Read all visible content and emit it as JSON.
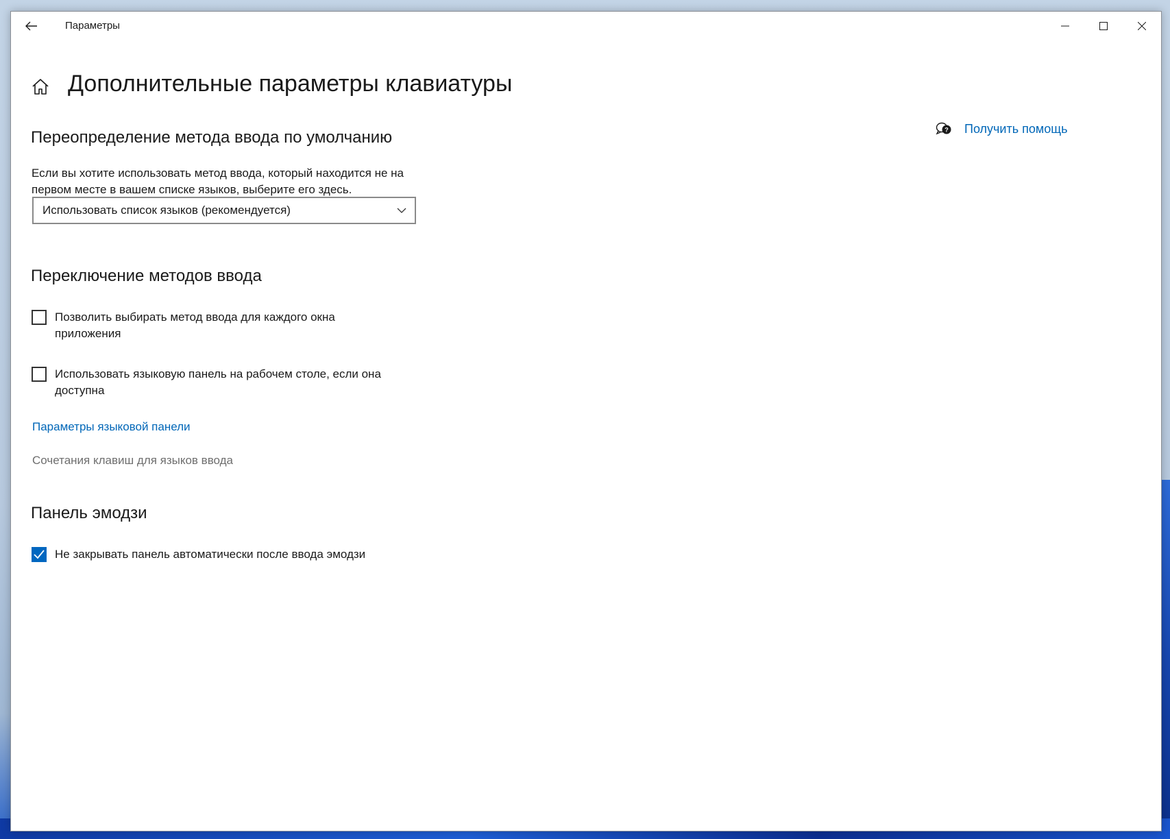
{
  "window": {
    "title": "Параметры"
  },
  "page": {
    "title": "Дополнительные параметры клавиатуры"
  },
  "help": {
    "label": "Получить помощь"
  },
  "override_section": {
    "heading": "Переопределение метода ввода по умолчанию",
    "description": "Если вы хотите использовать метод ввода, который находится не на первом месте в вашем списке языков, выберите его здесь.",
    "dropdown": {
      "selected": "Использовать список языков (рекомендуется)"
    }
  },
  "switching_section": {
    "heading": "Переключение методов ввода",
    "options": [
      {
        "label": "Позволить выбирать метод ввода для каждого окна приложения",
        "checked": false
      },
      {
        "label": "Использовать языковую панель на рабочем столе, если она доступна",
        "checked": false
      }
    ],
    "language_bar_link": "Параметры языковой панели",
    "hotkeys_link": "Сочетания клавиш для языков ввода"
  },
  "emoji_section": {
    "heading": "Панель эмодзи",
    "options": [
      {
        "label": "Не закрывать панель автоматически после ввода эмодзи",
        "checked": true
      }
    ]
  },
  "colors": {
    "accent": "#0067c0",
    "link": "#0067b8",
    "disabled_text": "#6e6e6e"
  }
}
